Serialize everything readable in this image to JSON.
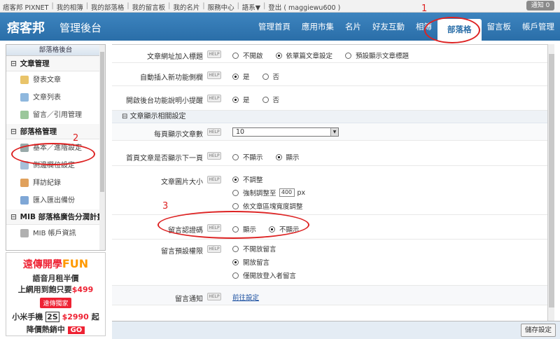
{
  "topbar": {
    "links": [
      "痞客邦 PIXNET",
      "我的相簿",
      "我的部落格",
      "我的留言板",
      "我的名片",
      "服務中心",
      "語系▼",
      "登出 ( maggiewu600 )"
    ],
    "notify": "通知 0"
  },
  "header": {
    "logo": "痞客邦",
    "admin_title": "管理後台",
    "nav": [
      "管理首頁",
      "應用市集",
      "名片",
      "好友互動",
      "相簿",
      "部落格",
      "留言板",
      "帳戶管理"
    ]
  },
  "sidebar": {
    "title": "部落格後台",
    "sections": [
      {
        "label": "文章管理",
        "items": [
          "發表文章",
          "文章列表",
          "留言／引用管理"
        ]
      },
      {
        "label": "部落格管理",
        "items": [
          "基本／進階設定",
          "側邊欄位設定",
          "拜訪紀錄",
          "匯入匯出備份"
        ]
      },
      {
        "label": "MIB 部落格廣告分潤計畫",
        "items": [
          "MIB 帳戶資訊"
        ]
      }
    ]
  },
  "ad": {
    "line1_a": "遠傳開學",
    "line1_b": "FUN",
    "line2": "語音月租半價",
    "line3_a": "上網用到飽只要",
    "line3_b": "$499",
    "badge": "遠傳獨家",
    "line4_a": "小米手機",
    "line4_b": "2S",
    "line4_c": "$2990",
    "line4_d": "起",
    "line5": "降價熱銷中",
    "go": "GO"
  },
  "form": {
    "help": "HELP",
    "rows": {
      "r1": {
        "label": "文章網址加入標題",
        "opts": [
          "不開啟",
          "依單篇文章設定",
          "預設顯示文章標題"
        ],
        "selected": 1
      },
      "r2": {
        "label": "自動插入新功能側欄",
        "opts": [
          "是",
          "否"
        ],
        "selected": 0
      },
      "r3": {
        "label": "開啟後台功能說明小提醒",
        "opts": [
          "是",
          "否"
        ],
        "selected": 0
      }
    },
    "section_title": "文章顯示相關設定",
    "per_page": {
      "label": "每頁顯示文章數",
      "value": "10"
    },
    "r5": {
      "label": "首頁文章是否顯示下一頁",
      "opts": [
        "不顯示",
        "顯示"
      ],
      "selected": 1
    },
    "img_size": {
      "label": "文章圖片大小",
      "opt1": "不調整",
      "opt2_a": "強制調整至",
      "opt2_val": "400",
      "opt2_b": "px",
      "opt3": "依文章區塊寬度調整",
      "selected": 0
    },
    "captcha": {
      "label": "留言認證碼",
      "opts": [
        "顯示",
        "不顯示"
      ],
      "selected": 1
    },
    "perm": {
      "label": "留言預設權限",
      "opts": [
        "不開放留言",
        "開放留言",
        "僅開放登入者留言"
      ],
      "selected": 1
    },
    "notify": {
      "label": "留言通知",
      "link": "前往設定"
    }
  },
  "save_label": "儲存設定",
  "annotations": {
    "n1": "1",
    "n2": "2",
    "n3": "3"
  }
}
